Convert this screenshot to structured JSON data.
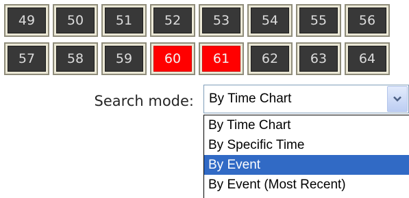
{
  "channel_grid": {
    "row1": [
      {
        "label": "49",
        "state": "inactive"
      },
      {
        "label": "50",
        "state": "inactive"
      },
      {
        "label": "51",
        "state": "inactive"
      },
      {
        "label": "52",
        "state": "inactive"
      },
      {
        "label": "53",
        "state": "inactive"
      },
      {
        "label": "54",
        "state": "inactive"
      },
      {
        "label": "55",
        "state": "inactive"
      },
      {
        "label": "56",
        "state": "inactive"
      }
    ],
    "row2": [
      {
        "label": "57",
        "state": "inactive"
      },
      {
        "label": "58",
        "state": "inactive"
      },
      {
        "label": "59",
        "state": "inactive"
      },
      {
        "label": "60",
        "state": "active"
      },
      {
        "label": "61",
        "state": "active"
      },
      {
        "label": "62",
        "state": "inactive"
      },
      {
        "label": "63",
        "state": "inactive"
      },
      {
        "label": "64",
        "state": "inactive"
      }
    ]
  },
  "search": {
    "label": "Search mode:",
    "selected_value": "By Time Chart",
    "dropdown_icon": "chevron-down-icon",
    "options": [
      {
        "label": "By Time Chart",
        "highlighted": false
      },
      {
        "label": "By Specific Time",
        "highlighted": false
      },
      {
        "label": "By Event",
        "highlighted": true
      },
      {
        "label": "By Event (Most Recent)",
        "highlighted": false
      }
    ]
  },
  "colors": {
    "cell_inactive": "#383838",
    "cell_active": "#ff0000",
    "highlight": "#316ac5"
  }
}
